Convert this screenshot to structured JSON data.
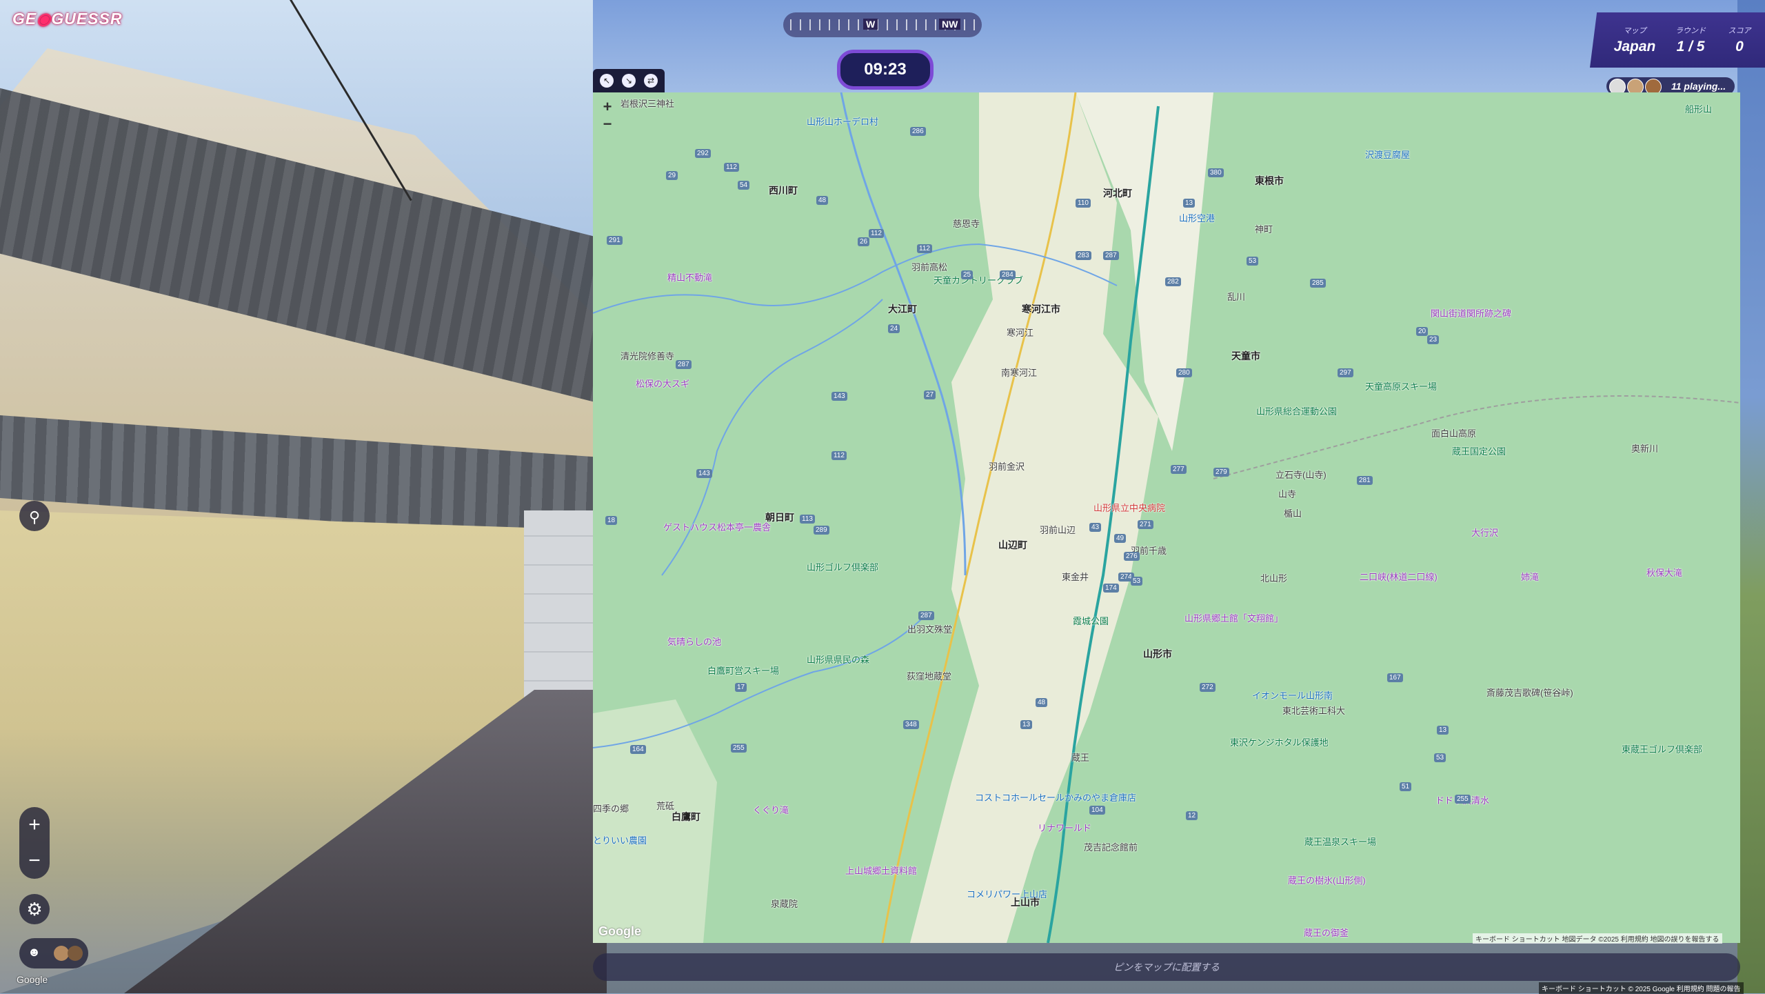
{
  "brand": {
    "logo_text_a": "GE",
    "logo_text_b": "GUESSR"
  },
  "compass": {
    "labels": [
      "W",
      "NW"
    ]
  },
  "timer": {
    "value": "09:23"
  },
  "score_panel": {
    "map_label": "マップ",
    "map_value": "Japan",
    "round_label": "ラウンド",
    "round_value": "1 / 5",
    "score_label": "スコア",
    "score_value": "0"
  },
  "players_badge": {
    "text": "11 playing..."
  },
  "controls": {
    "zoom_in": "+",
    "zoom_out": "−"
  },
  "streetview": {
    "google_label": "Google"
  },
  "map": {
    "zoom_in": "+",
    "zoom_out": "−",
    "google_logo": "Google",
    "attribution": "キーボード ショートカット   地図データ ©2025   利用規約   地図の誤りを報告する",
    "labels": [
      {
        "text": "岩根沢三神社",
        "cls": ""
      },
      {
        "text": "山形山ホーデロ村",
        "cls": "poi-blue"
      },
      {
        "text": "西川町",
        "cls": "city"
      },
      {
        "text": "河北町",
        "cls": "city"
      },
      {
        "text": "東根市",
        "cls": "city"
      },
      {
        "text": "沢渡豆腐屋",
        "cls": "poi-blue"
      },
      {
        "text": "慈恩寺",
        "cls": ""
      },
      {
        "text": "山形空港",
        "cls": "poi-blue"
      },
      {
        "text": "神町",
        "cls": ""
      },
      {
        "text": "羽前高松",
        "cls": ""
      },
      {
        "text": "精山不動滝",
        "cls": "poi-purple"
      },
      {
        "text": "大江町",
        "cls": "city"
      },
      {
        "text": "寒河江市",
        "cls": "city"
      },
      {
        "text": "寒河江",
        "cls": ""
      },
      {
        "text": "天童カントリークラブ",
        "cls": "poi-green"
      },
      {
        "text": "乱川",
        "cls": ""
      },
      {
        "text": "関山街道関所跡之碑",
        "cls": "poi-purple"
      },
      {
        "text": "清光院修善寺",
        "cls": ""
      },
      {
        "text": "天童市",
        "cls": "city"
      },
      {
        "text": "南寒河江",
        "cls": ""
      },
      {
        "text": "松保の大スギ",
        "cls": "poi-purple"
      },
      {
        "text": "天童高原スキー場",
        "cls": "poi-green"
      },
      {
        "text": "山形県総合運動公園",
        "cls": "poi-green"
      },
      {
        "text": "面白山高原",
        "cls": ""
      },
      {
        "text": "蔵王国定公園",
        "cls": "poi-green"
      },
      {
        "text": "奥新川",
        "cls": ""
      },
      {
        "text": "羽前金沢",
        "cls": ""
      },
      {
        "text": "立石寺(山寺)",
        "cls": ""
      },
      {
        "text": "山寺",
        "cls": ""
      },
      {
        "text": "山形県立中央病院",
        "cls": "poi-red"
      },
      {
        "text": "楯山",
        "cls": ""
      },
      {
        "text": "朝日町",
        "cls": "city"
      },
      {
        "text": "ゲストハウス松本亭一農舎",
        "cls": "poi-purple"
      },
      {
        "text": "羽前山辺",
        "cls": ""
      },
      {
        "text": "大行沢",
        "cls": "poi-purple"
      },
      {
        "text": "山辺町",
        "cls": "city"
      },
      {
        "text": "羽前千歳",
        "cls": ""
      },
      {
        "text": "山形ゴルフ倶楽部",
        "cls": "poi-green"
      },
      {
        "text": "東金井",
        "cls": ""
      },
      {
        "text": "北山形",
        "cls": ""
      },
      {
        "text": "二口峡(林道二口線)",
        "cls": "poi-purple"
      },
      {
        "text": "姉滝",
        "cls": "poi-purple"
      },
      {
        "text": "秋保大滝",
        "cls": "poi-purple"
      },
      {
        "text": "霞城公園",
        "cls": "poi-green"
      },
      {
        "text": "山形県郷土館「文翔館」",
        "cls": "poi-purple"
      },
      {
        "text": "出羽文殊堂",
        "cls": ""
      },
      {
        "text": "気晴らしの池",
        "cls": "poi-purple"
      },
      {
        "text": "山形市",
        "cls": "city"
      },
      {
        "text": "山形県県民の森",
        "cls": "poi-green"
      },
      {
        "text": "白鷹町営スキー場",
        "cls": "poi-green"
      },
      {
        "text": "荻窪地蔵堂",
        "cls": ""
      },
      {
        "text": "斎藤茂吉歌碑(笹谷峠)",
        "cls": ""
      },
      {
        "text": "イオンモール山形南",
        "cls": "poi-blue"
      },
      {
        "text": "東北芸術工科大",
        "cls": ""
      },
      {
        "text": "東沢ケンジホタル保護地",
        "cls": "poi-green"
      },
      {
        "text": "東蔵王ゴルフ倶楽部",
        "cls": "poi-green"
      },
      {
        "text": "蔵王",
        "cls": ""
      },
      {
        "text": "四季の郷",
        "cls": ""
      },
      {
        "text": "荒砥",
        "cls": ""
      },
      {
        "text": "白鷹町",
        "cls": "city"
      },
      {
        "text": "くぐり滝",
        "cls": "poi-purple"
      },
      {
        "text": "コストコホールセールかみのやま倉庫店",
        "cls": "poi-blue"
      },
      {
        "text": "リナワールド",
        "cls": "poi-purple"
      },
      {
        "text": "ドドウ沢清水",
        "cls": "poi-purple"
      },
      {
        "text": "とりいい農園",
        "cls": "poi-blue"
      },
      {
        "text": "茂吉記念館前",
        "cls": ""
      },
      {
        "text": "蔵王温泉スキー場",
        "cls": "poi-green"
      },
      {
        "text": "上山城郷土資料館",
        "cls": "poi-purple"
      },
      {
        "text": "蔵王の樹氷(山形側)",
        "cls": "poi-purple"
      },
      {
        "text": "コメリパワー上山店",
        "cls": "poi-blue"
      },
      {
        "text": "上山市",
        "cls": "city"
      },
      {
        "text": "泉蔵院",
        "cls": ""
      },
      {
        "text": "蔵王の御釜",
        "cls": "poi-purple"
      },
      {
        "text": "船形山",
        "cls": "poi-green"
      }
    ],
    "routes": [
      "292",
      "29",
      "112",
      "54",
      "291",
      "112",
      "286",
      "48",
      "26",
      "112",
      "287",
      "283",
      "284",
      "282",
      "285",
      "110",
      "380",
      "13",
      "53",
      "25",
      "24",
      "27",
      "143",
      "287",
      "112",
      "143",
      "113",
      "18",
      "289",
      "287",
      "49",
      "43",
      "276",
      "274",
      "174",
      "271",
      "279",
      "277",
      "20",
      "23",
      "280",
      "297",
      "281",
      "48",
      "272",
      "167",
      "17",
      "53",
      "13",
      "164",
      "255",
      "348",
      "104",
      "13",
      "12",
      "53",
      "51",
      "255"
    ],
    "place_pin_text": "ピンをマップに配置する"
  },
  "footer": {
    "text": "キーボード ショートカット   © 2025 Google   利用規約   問題の報告"
  }
}
